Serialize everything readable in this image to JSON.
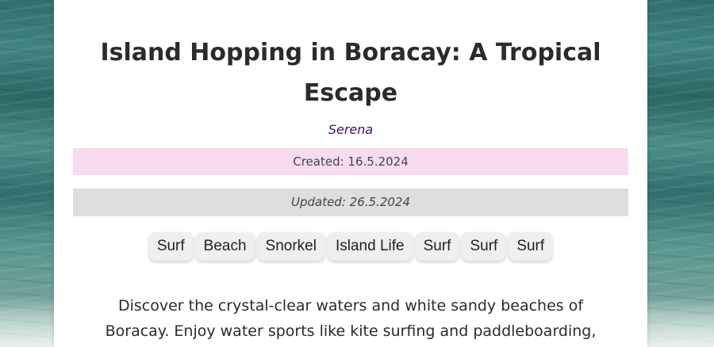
{
  "post": {
    "title": "Island Hopping in Boracay: A Tropical Escape",
    "author": "Serena",
    "created": "Created: 16.5.2024",
    "updated": "Updated: 26.5.2024",
    "tags": [
      "Surf",
      "Beach",
      "Snorkel",
      "Island Life",
      "Surf",
      "Surf",
      "Surf"
    ],
    "description": "Discover the crystal-clear waters and white sandy beaches of Boracay. Enjoy water sports like kite surfing and paddleboarding,"
  },
  "colors": {
    "created_bg": "#f7dcf0",
    "updated_bg": "#dedede",
    "author": "#4b0b82"
  }
}
